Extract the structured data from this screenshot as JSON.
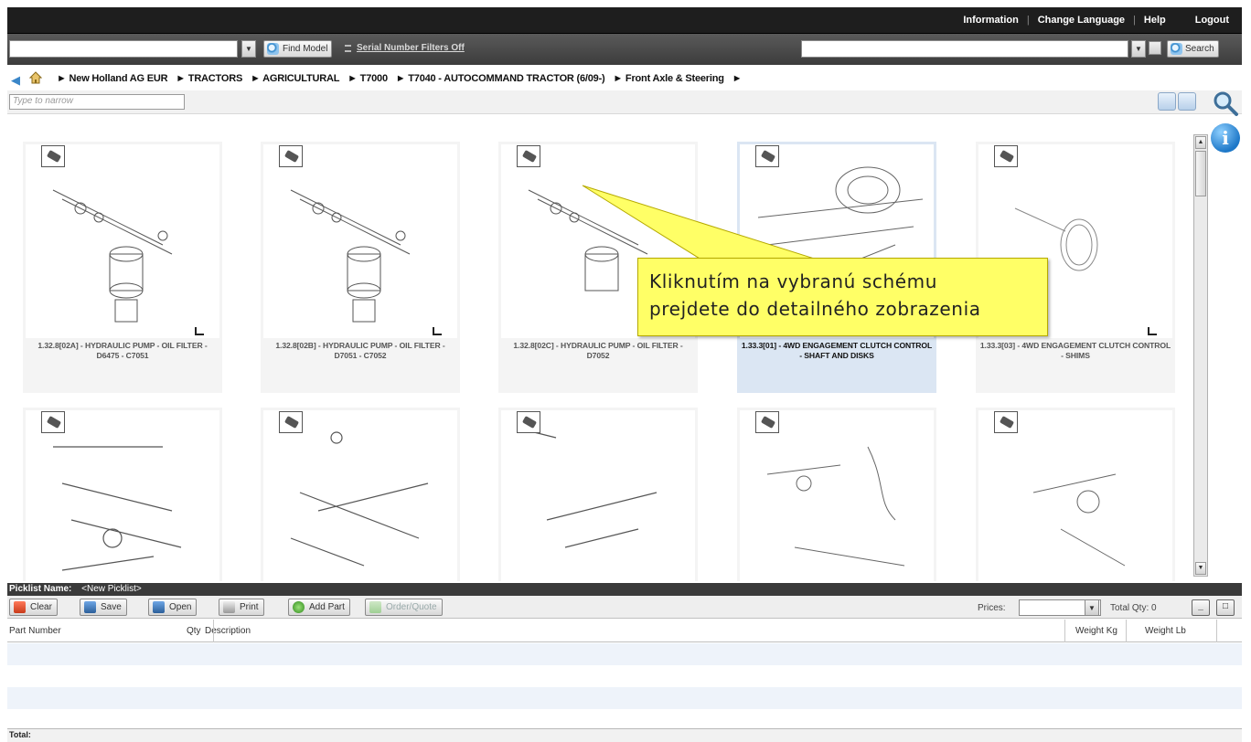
{
  "top_menu": {
    "information": "Information",
    "change_language": "Change Language",
    "help": "Help",
    "logout": "Logout",
    "separator": "|"
  },
  "toolbar": {
    "model_combo_value": "",
    "find_model": "Find Model",
    "serial_filter": "Serial Number Filters Off",
    "search_value": "",
    "search_button": "Search"
  },
  "breadcrumb": [
    "► New Holland AG EUR",
    "► TRACTORS",
    "► AGRICULTURAL",
    "► T7000",
    "► T7040 - AUTOCOMMAND TRACTOR (6/09-)",
    "► Front Axle & Steering",
    "►"
  ],
  "narrow": {
    "placeholder": "Type to narrow"
  },
  "cards_row1": [
    {
      "caption": "1.32.8[02A] - HYDRAULIC PUMP - OIL FILTER - D6475 - C7051"
    },
    {
      "caption": "1.32.8[02B] - HYDRAULIC PUMP - OIL FILTER - D7051 - C7052"
    },
    {
      "caption": "1.32.8[02C] - HYDRAULIC PUMP - OIL FILTER - D7052"
    },
    {
      "caption": "1.33.3[01] - 4WD ENGAGEMENT CLUTCH CONTROL - SHAFT AND DISKS"
    },
    {
      "caption": "1.33.3[03] - 4WD ENGAGEMENT CLUTCH CONTROL - SHIMS"
    }
  ],
  "callout": {
    "line1": "Kliknutím na vybranú schému",
    "line2": "prejdete do detailného zobrazenia"
  },
  "picklist": {
    "label": "Picklist Name:",
    "name": "<New Picklist>",
    "clear": "Clear",
    "save": "Save",
    "open": "Open",
    "print": "Print",
    "add_part": "Add Part",
    "order_quote": "Order/Quote",
    "prices_label": "Prices:",
    "prices_value": "",
    "total_qty": "Total Qty: 0",
    "min": "_",
    "max": "□"
  },
  "table": {
    "columns": [
      "Part Number",
      "Qty",
      "Description",
      "Weight Kg",
      "Weight Lb"
    ],
    "total_label": "Total:"
  },
  "colors": {
    "topbar": "#1e1e1e",
    "toolbar": "#484848",
    "callout": "#ffff66",
    "selected_card": "#dbe6f3",
    "accent": "#2a83c8"
  }
}
